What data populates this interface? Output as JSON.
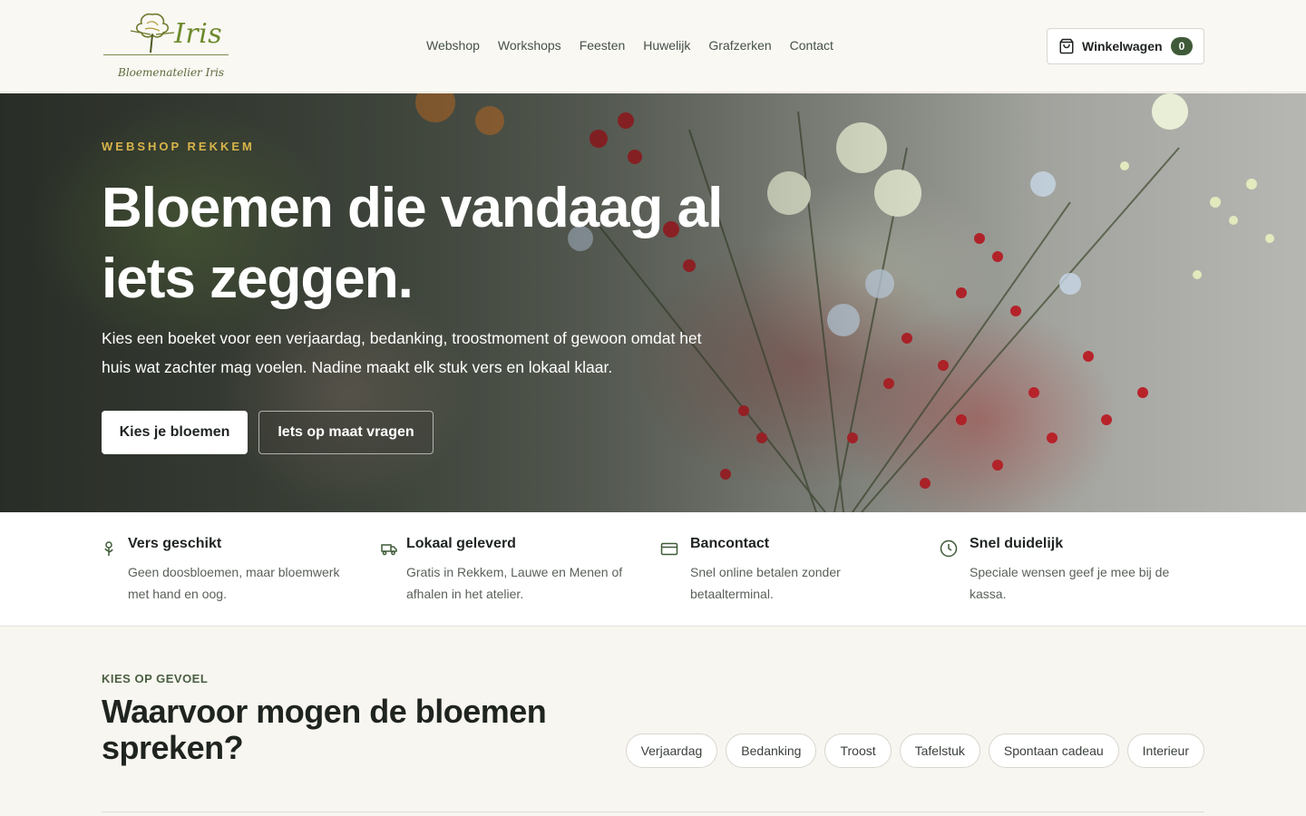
{
  "header": {
    "logo_word": "Iris",
    "logo_sub": "Bloemenatelier Iris",
    "nav": [
      "Webshop",
      "Workshops",
      "Feesten",
      "Huwelijk",
      "Grafzerken",
      "Contact"
    ],
    "cart_label": "Winkelwagen",
    "cart_count": "0"
  },
  "hero": {
    "eyebrow": "WEBSHOP REKKEM",
    "title": "Bloemen die vandaag al iets zeggen.",
    "text": "Kies een boeket voor een verjaardag, bedanking, troostmoment of gewoon omdat het huis wat zachter mag voelen. Nadine maakt elk stuk vers en lokaal klaar.",
    "primary_button": "Kies je bloemen",
    "secondary_button": "Iets op maat vragen"
  },
  "features": [
    {
      "icon": "flower-icon",
      "title": "Vers geschikt",
      "text": "Geen doosbloemen, maar bloemwerk met hand en oog."
    },
    {
      "icon": "truck-icon",
      "title": "Lokaal geleverd",
      "text": "Gratis in Rekkem, Lauwe en Menen of afhalen in het atelier."
    },
    {
      "icon": "credit-card-icon",
      "title": "Bancontact",
      "text": "Snel online betalen zonder betaalterminal."
    },
    {
      "icon": "clock-icon",
      "title": "Snel duidelijk",
      "text": "Speciale wensen geef je mee bij de kassa."
    }
  ],
  "section": {
    "kicker": "KIES OP GEVOEL",
    "title": "Waarvoor mogen de bloemen spreken?",
    "chips": [
      "Verjaardag",
      "Bedanking",
      "Troost",
      "Tafelstuk",
      "Spontaan cadeau",
      "Interieur"
    ]
  },
  "colors": {
    "accent_green": "#3f5a38",
    "eyebrow_gold": "#d8b44a",
    "logo_green": "#6d8a2c"
  }
}
